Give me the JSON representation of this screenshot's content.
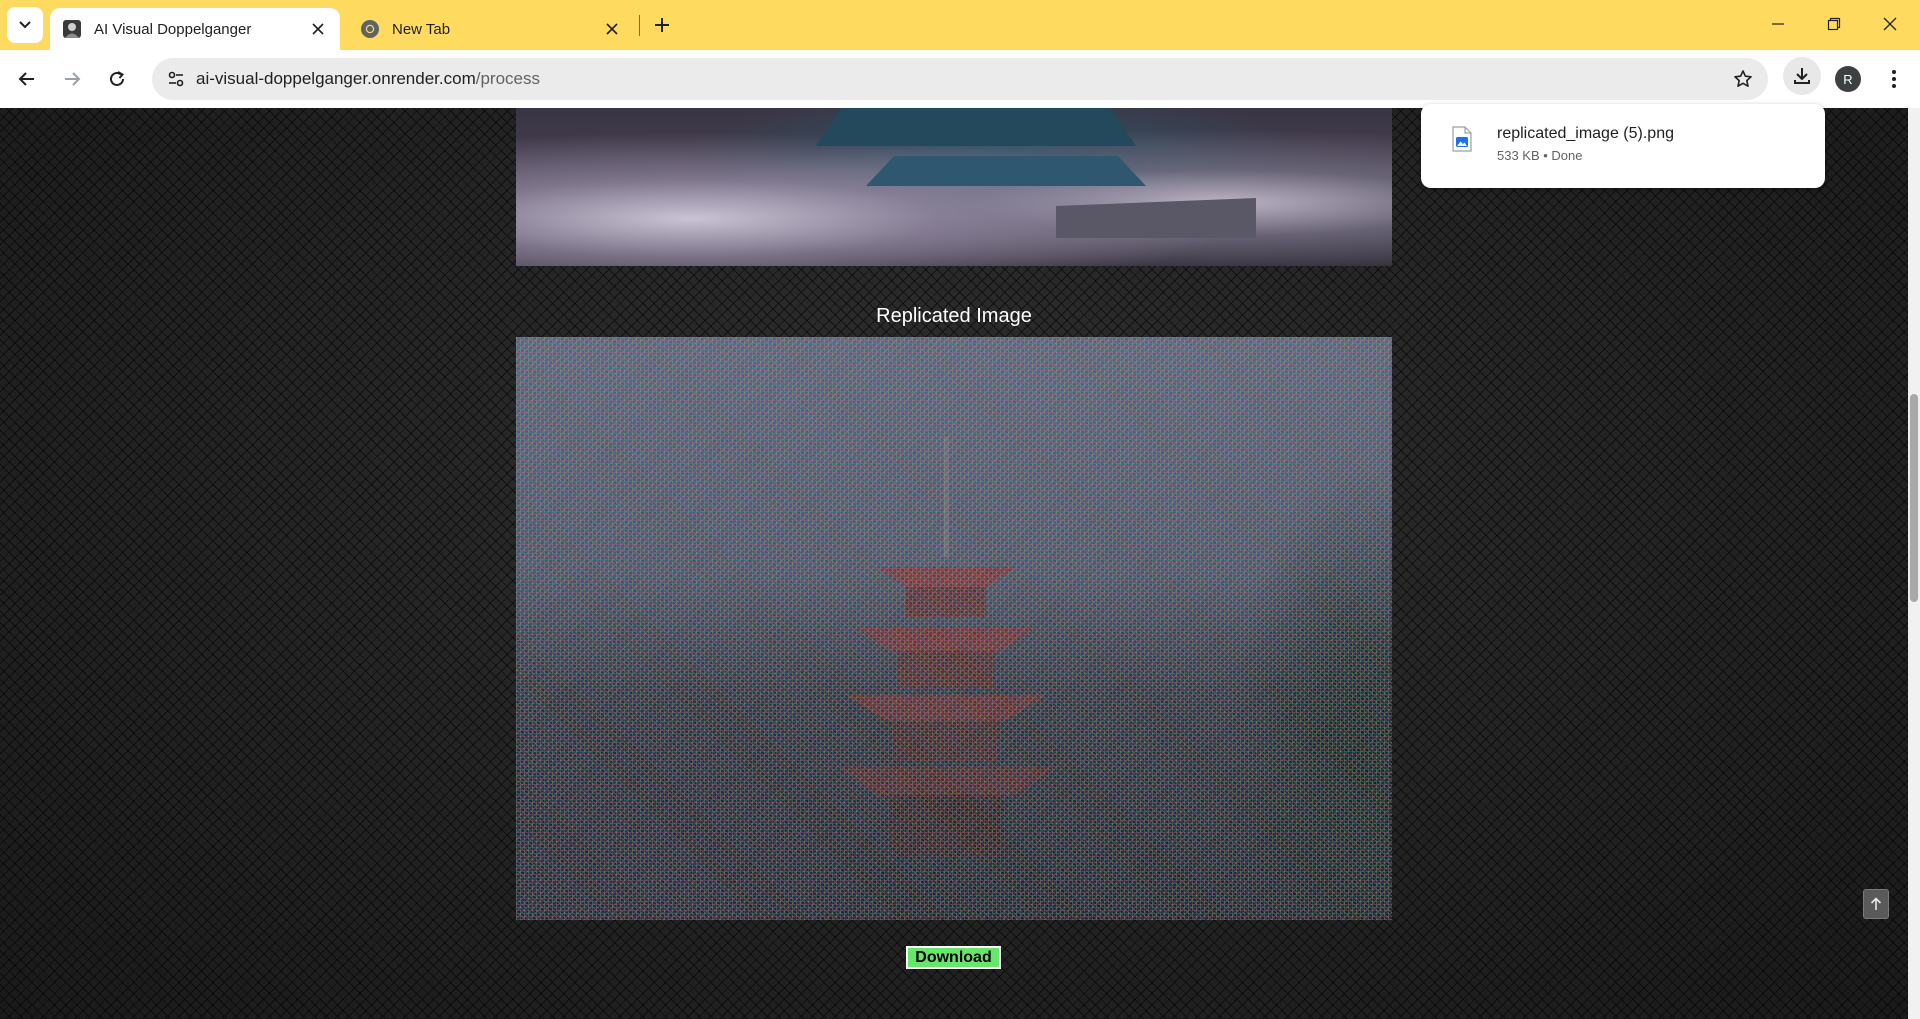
{
  "browser": {
    "tabs": [
      {
        "title": "AI Visual Doppelganger",
        "active": true,
        "favicon": "site-logo-icon"
      },
      {
        "title": "New Tab",
        "active": false,
        "favicon": "chrome-icon"
      }
    ],
    "url": {
      "host": "ai-visual-doppelganger.onrender.com",
      "path": "/process"
    },
    "profile_initial": "R",
    "accent_color": "#fedb5e"
  },
  "downloads": {
    "filename": "replicated_image (5).png",
    "meta": "533 KB • Done"
  },
  "page": {
    "section_title": "Replicated Image",
    "download_label": "Download",
    "button_color": "#66e66a"
  }
}
